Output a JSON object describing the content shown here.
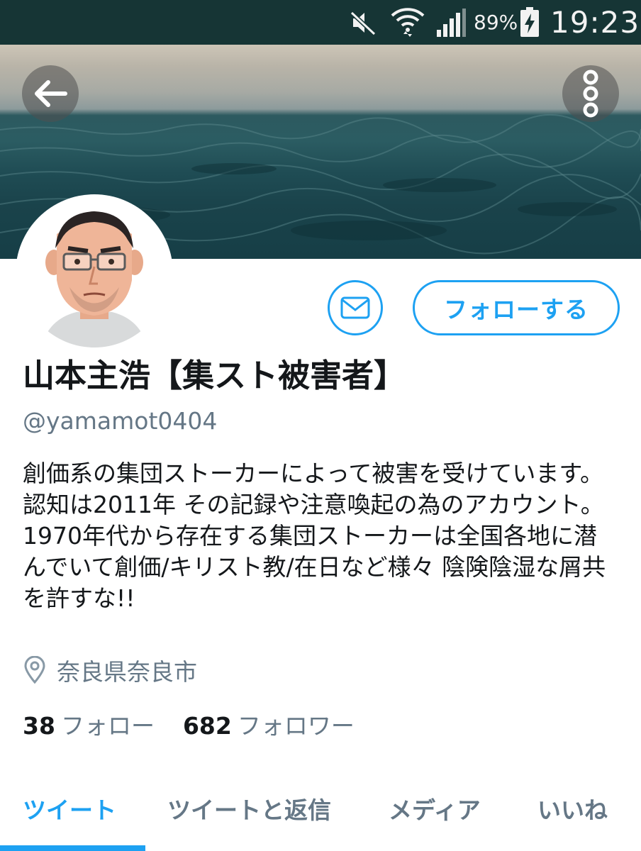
{
  "status_bar": {
    "battery_percent": "89%",
    "time": "19:23",
    "icons": [
      "mute-icon",
      "wifi-icon",
      "signal-icon",
      "battery-charging-icon"
    ]
  },
  "header": {
    "back_icon": "arrow-left-icon",
    "more_icon": "more-vertical-icon"
  },
  "profile": {
    "name": "山本主浩【集スト被害者】",
    "handle": "@yamamot0404",
    "bio": "創価系の集団ストーカーによって被害を受けています。認知は2011年 その記録や注意喚起の為のアカウント。 1970年代から存在する集団ストーカーは全国各地に潜んでいて創価/キリスト教/在日など様々 陰険陰湿な屑共を許すな!!",
    "location": "奈良県奈良市",
    "following_count": "38",
    "following_label": "フォロー",
    "followers_count": "682",
    "followers_label": "フォロワー"
  },
  "actions": {
    "dm_icon": "mail-icon",
    "follow_label": "フォローする"
  },
  "tabs": [
    {
      "label": "ツイート",
      "active": true
    },
    {
      "label": "ツイートと返信",
      "active": false
    },
    {
      "label": "メディア",
      "active": false
    },
    {
      "label": "いいね",
      "active": false
    }
  ],
  "colors": {
    "accent": "#1da1f2",
    "status_bar": "#163535",
    "secondary_text": "#657786"
  }
}
